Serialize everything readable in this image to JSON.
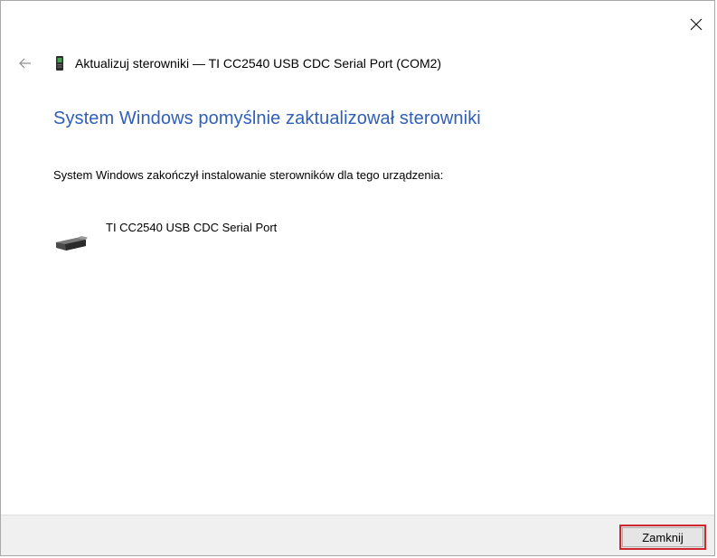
{
  "window": {
    "title": "Aktualizuj sterowniki — TI CC2540 USB CDC Serial Port (COM2)",
    "close_icon": "close-icon",
    "back_icon": "back-arrow-icon",
    "device_icon": "device-icon"
  },
  "content": {
    "heading": "System Windows pomyślnie zaktualizował sterowniki",
    "subtext": "System Windows zakończył instalowanie sterowników dla tego urządzenia:",
    "device_name": "TI CC2540 USB CDC Serial Port",
    "device_icon": "usb-device-icon"
  },
  "footer": {
    "close_button_label": "Zamknij"
  },
  "colors": {
    "heading": "#2f5fb8",
    "highlight_border": "#d0272f",
    "footer_bg": "#f0f0f0"
  }
}
